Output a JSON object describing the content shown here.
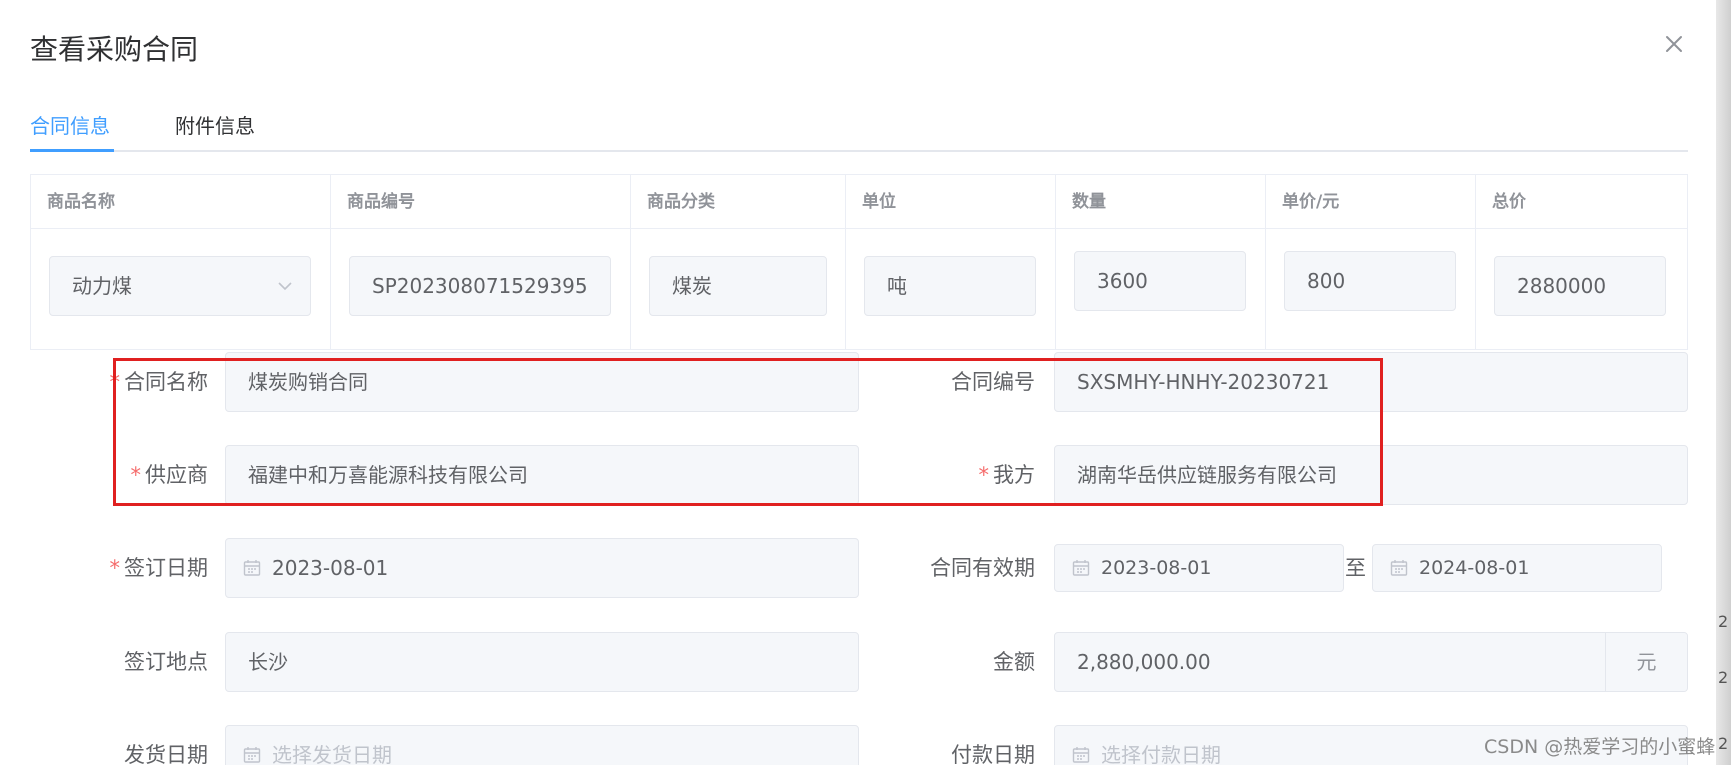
{
  "dialog": {
    "title": "查看采购合同",
    "close_icon": "close-icon"
  },
  "tabs": [
    {
      "label": "合同信息",
      "active": true
    },
    {
      "label": "附件信息",
      "active": false
    }
  ],
  "goods_table": {
    "headers": [
      "商品名称",
      "商品编号",
      "商品分类",
      "单位",
      "数量",
      "单价/元",
      "总价"
    ],
    "row": {
      "name": "动力煤",
      "code": "SP202308071529395",
      "category": "煤炭",
      "unit": "吨",
      "quantity": "3600",
      "unit_price": "800",
      "total": "2880000"
    }
  },
  "form": {
    "contract_name": {
      "label": "合同名称",
      "value": "煤炭购销合同",
      "required": true
    },
    "contract_no": {
      "label": "合同编号",
      "value": "SXSMHY-HNHY-20230721"
    },
    "supplier": {
      "label": "供应商",
      "value": "福建中和万喜能源科技有限公司",
      "required": true
    },
    "our_party": {
      "label": "我方",
      "value": "湖南华岳供应链服务有限公司",
      "required": true
    },
    "sign_date": {
      "label": "签订日期",
      "value": "2023-08-01",
      "required": true
    },
    "valid_period": {
      "label": "合同有效期",
      "start": "2023-08-01",
      "separator": "至",
      "end": "2024-08-01"
    },
    "sign_place": {
      "label": "签订地点",
      "value": "长沙"
    },
    "amount": {
      "label": "金额",
      "value": "2,880,000.00",
      "unit": "元"
    },
    "ship_date": {
      "label": "发货日期",
      "placeholder": "选择发货日期"
    },
    "pay_date": {
      "label": "付款日期",
      "placeholder": "选择付款日期"
    }
  },
  "required_mark": "*",
  "watermark": "CSDN @热爱学习的小蜜蜂",
  "edge_chars": [
    "2",
    "2",
    "2"
  ],
  "colors": {
    "accent": "#409eff",
    "required": "#f56c6c",
    "highlight": "#e02020",
    "input_bg": "#f5f7fa"
  }
}
